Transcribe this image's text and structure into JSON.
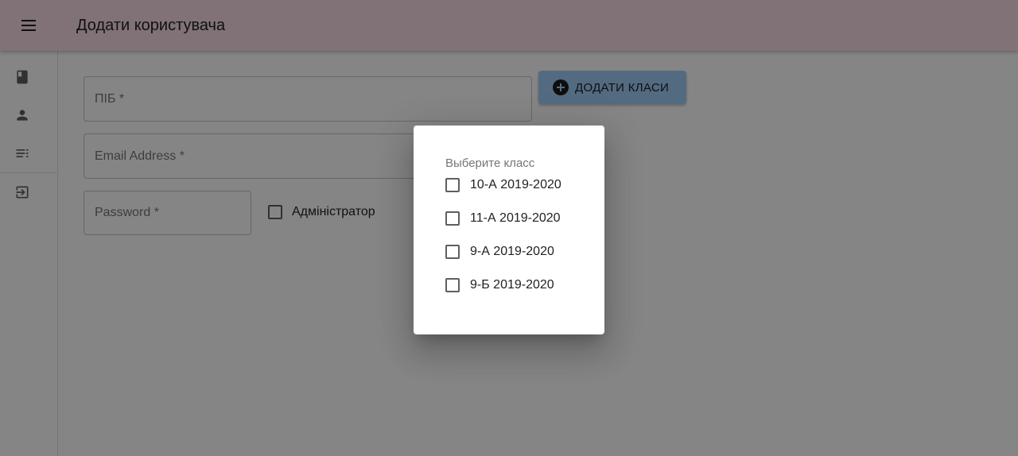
{
  "appbar": {
    "title": "Додати користувача",
    "menu_icon": "menu-icon"
  },
  "drawer": {
    "items": [
      {
        "icon": "book-icon",
        "name": "drawer-item-book"
      },
      {
        "icon": "person-icon",
        "name": "drawer-item-person"
      },
      {
        "icon": "list-icon",
        "name": "drawer-item-list"
      },
      {
        "icon": "exit-icon",
        "name": "drawer-item-exit"
      }
    ]
  },
  "form": {
    "name_placeholder": "ПІБ *",
    "email_placeholder": "Email Address *",
    "password_placeholder": "Password *",
    "add_classes_label": "ДОДАТИ КЛАСИ",
    "admin_label": "Адміністратор",
    "admin_checked": false
  },
  "dialog": {
    "label": "Выберите класс",
    "options": [
      {
        "label": "10-А 2019-2020",
        "checked": false
      },
      {
        "label": "11-А 2019-2020",
        "checked": false
      },
      {
        "label": "9-А 2019-2020",
        "checked": false
      },
      {
        "label": "9-Б 2019-2020",
        "checked": false
      }
    ]
  },
  "colors": {
    "appbar": "#f5dbe2",
    "button": "#9fcdf5",
    "backdrop": "rgba(0,0,0,0.48)"
  }
}
